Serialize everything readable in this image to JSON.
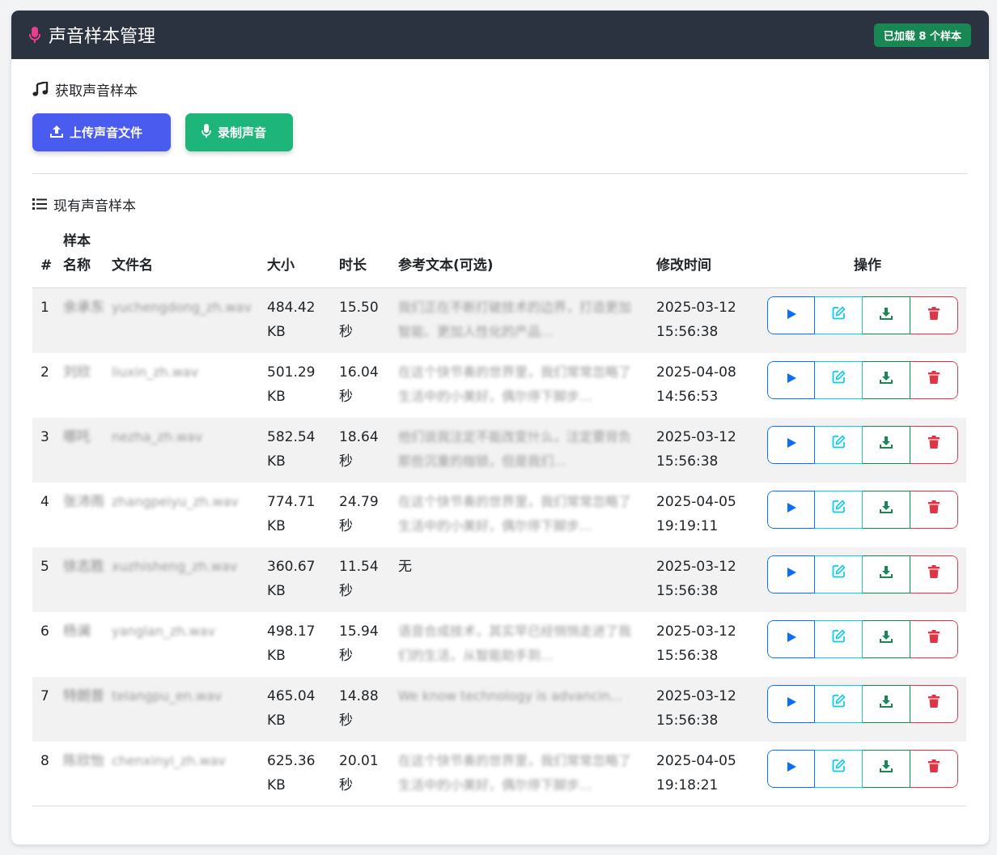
{
  "header": {
    "title": "声音样本管理",
    "badge": "已加载 8 个样本",
    "icon": "microphone-icon",
    "accent": "#e83e8c"
  },
  "acquire": {
    "title": "获取声音样本",
    "icon": "music-note-icon",
    "upload_label": "上传声音文件",
    "record_label": "录制声音",
    "upload_color": "#4a5cf0",
    "record_color": "#1db57a"
  },
  "existing": {
    "title": "现有声音样本",
    "icon": "list-icon",
    "columns": {
      "idx": "#",
      "name_line1": "样本",
      "name_line2": "名称",
      "filename": "文件名",
      "size": "大小",
      "duration": "时长",
      "ref_text": "参考文本(可选)",
      "modified": "修改时间",
      "actions": "操作"
    },
    "rows": [
      {
        "idx": "1",
        "name": "余承东",
        "filename": "yuchengdong_zh.wav",
        "size_num": "484.42",
        "size_unit": "KB",
        "dur_num": "15.50",
        "dur_unit": "秒",
        "ref": "我们正在不断打破技术的边界，打造更加智能、更加人性化的产品...",
        "date": "2025-03-12",
        "time": "15:56:38"
      },
      {
        "idx": "2",
        "name": "刘欣",
        "filename": "liuxin_zh.wav",
        "size_num": "501.29",
        "size_unit": "KB",
        "dur_num": "16.04",
        "dur_unit": "秒",
        "ref": "在这个快节奏的世界里，我们常常忽略了生活中的小美好，偶尔停下脚步...",
        "date": "2025-04-08",
        "time": "14:56:53"
      },
      {
        "idx": "3",
        "name": "哪吒",
        "filename": "nezha_zh.wav",
        "size_num": "582.54",
        "size_unit": "KB",
        "dur_num": "18.64",
        "dur_unit": "秒",
        "ref": "他们说我注定不能改变什么，注定要背负那些沉重的枷锁，但是我们...",
        "date": "2025-03-12",
        "time": "15:56:38"
      },
      {
        "idx": "4",
        "name": "张沛雨",
        "filename": "zhangpeiyu_zh.wav",
        "size_num": "774.71",
        "size_unit": "KB",
        "dur_num": "24.79",
        "dur_unit": "秒",
        "ref": "在这个快节奏的世界里，我们常常忽略了生活中的小美好，偶尔停下脚步...",
        "date": "2025-04-05",
        "time": "19:19:11"
      },
      {
        "idx": "5",
        "name": "徐志胜",
        "filename": "xuzhisheng_zh.wav",
        "size_num": "360.67",
        "size_unit": "KB",
        "dur_num": "11.54",
        "dur_unit": "秒",
        "ref": "无",
        "date": "2025-03-12",
        "time": "15:56:38"
      },
      {
        "idx": "6",
        "name": "杨澜",
        "filename": "yanglan_zh.wav",
        "size_num": "498.17",
        "size_unit": "KB",
        "dur_num": "15.94",
        "dur_unit": "秒",
        "ref": "语音合成技术，其实早已经悄悄走进了我们的生活，从智能助手到...",
        "date": "2025-03-12",
        "time": "15:56:38"
      },
      {
        "idx": "7",
        "name": "特朗普",
        "filename": "telangpu_en.wav",
        "size_num": "465.04",
        "size_unit": "KB",
        "dur_num": "14.88",
        "dur_unit": "秒",
        "ref": "We know technology is advancin...",
        "date": "2025-03-12",
        "time": "15:56:38"
      },
      {
        "idx": "8",
        "name": "陈欣怡",
        "filename": "chenxinyi_zh.wav",
        "size_num": "625.36",
        "size_unit": "KB",
        "dur_num": "20.01",
        "dur_unit": "秒",
        "ref": "在这个快节奏的世界里，我们常常忽略了生活中的小美好，偶尔停下脚步...",
        "date": "2025-04-05",
        "time": "19:18:21"
      }
    ],
    "row_actions": [
      "play-icon",
      "edit-icon",
      "download-icon",
      "trash-icon"
    ],
    "action_colors": {
      "play": "#0d6efd",
      "edit": "#0dcaf0",
      "download": "#198754",
      "delete": "#dc3545"
    }
  }
}
